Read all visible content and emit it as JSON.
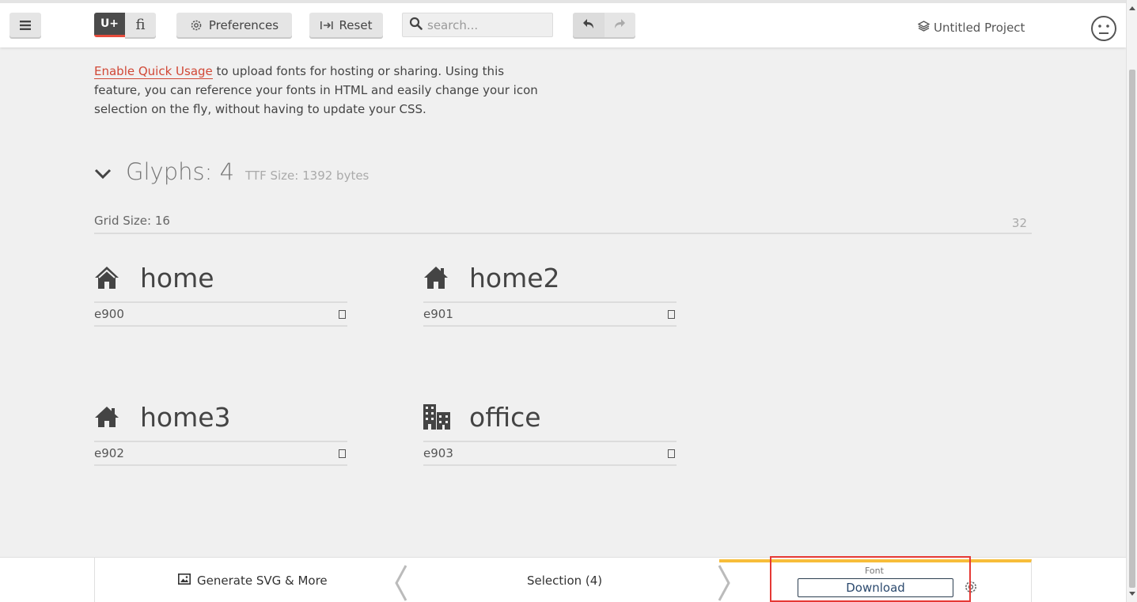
{
  "toolbar": {
    "unicode_label": "U+",
    "ligature_label": "ﬁ",
    "preferences_label": "Preferences",
    "reset_label": "Reset",
    "search_placeholder": "search...",
    "project_name": "Untitled Project"
  },
  "intro": {
    "link_text": "Enable Quick Usage",
    "text": " to upload fonts for hosting or sharing. Using this feature, you can reference your fonts in HTML and easily change your icon selection on the fly, without having to update your CSS."
  },
  "glyphs_section": {
    "title_label": "Glyphs:",
    "count": "4",
    "ttf_size": "TTF Size: 1392 bytes",
    "grid_size_label": "Grid Size: 16",
    "grid_max": "32"
  },
  "glyphs": [
    {
      "name": "home",
      "code": "e900",
      "icon": "home-icon"
    },
    {
      "name": "home2",
      "code": "e901",
      "icon": "home2-icon"
    },
    {
      "name": "home3",
      "code": "e902",
      "icon": "home3-icon"
    },
    {
      "name": "office",
      "code": "e903",
      "icon": "office-icon"
    }
  ],
  "bottom": {
    "generate_label": "Generate SVG & More",
    "selection_label": "Selection (4)",
    "font_label": "Font",
    "download_label": "Download"
  },
  "colors": {
    "accent_red": "#e74c3c",
    "font_tab_yellow": "#f7bd3a",
    "highlight": "#e53935"
  }
}
